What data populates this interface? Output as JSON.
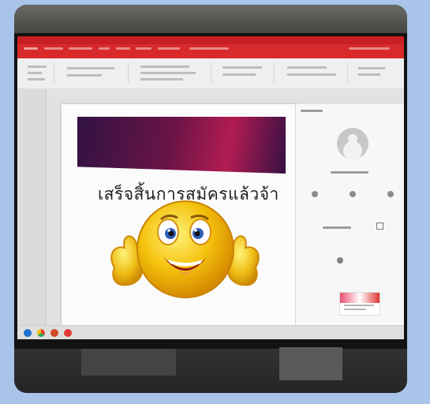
{
  "slide": {
    "text": "เสร็จสิ้นการสมัครแล้วจ้า"
  },
  "colors": {
    "ribbon_red": "#d82a2b",
    "banner_start": "#321244",
    "banner_end": "#b21c52",
    "emoji_yellow": "#f4c20d"
  },
  "icons": [
    "windows-logo-icon",
    "chrome-icon",
    "powerpoint-icon",
    "avatar-icon"
  ]
}
